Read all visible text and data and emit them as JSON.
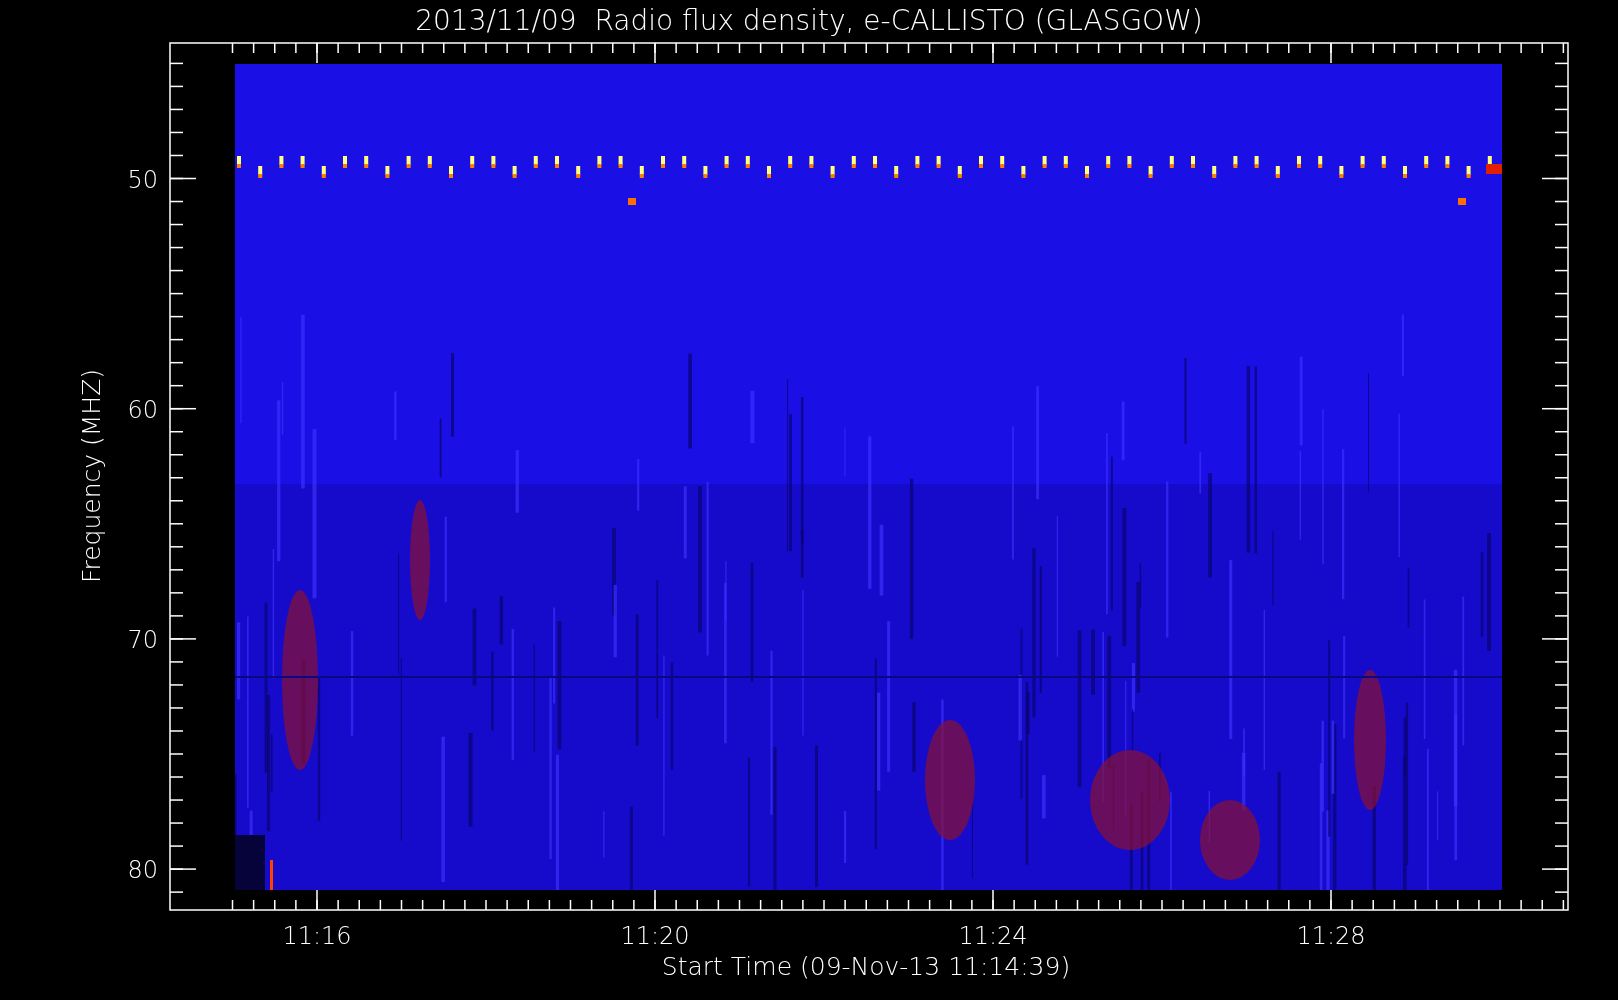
{
  "chart": {
    "title": "2013/11/09  Radio flux density, e-CALLISTO (GLASGOW)",
    "ylabel": "Frequency (MHZ)",
    "xlabel": "Start Time (09-Nov-13 11:14:39)",
    "yticks": [
      "50",
      "60",
      "70",
      "80"
    ],
    "xticks": [
      "11:16",
      "11:20",
      "11:24",
      "11:28"
    ]
  }
}
